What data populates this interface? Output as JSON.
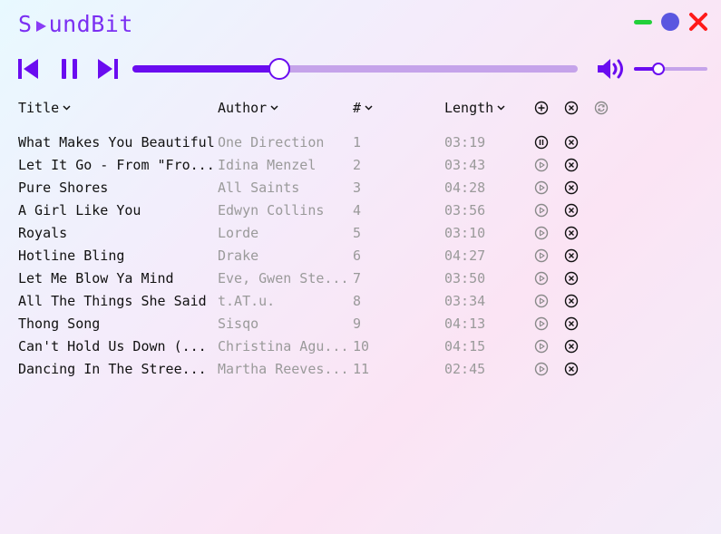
{
  "app": {
    "logo_prefix": "S",
    "logo_suffix": "undBit"
  },
  "window_controls": {
    "minimize": "minimize",
    "maximize": "maximize",
    "close": "close"
  },
  "player": {
    "progress_percent": 33,
    "volume_percent": 33,
    "state": "playing"
  },
  "columns": {
    "title": "Title",
    "author": "Author",
    "number": "#",
    "length": "Length"
  },
  "tracks": [
    {
      "title": "What Makes You Beautiful",
      "author": "One Direction",
      "num": "1",
      "length": "03:19",
      "playing": true
    },
    {
      "title": "Let It Go - From \"Fro...",
      "author": "Idina Menzel",
      "num": "2",
      "length": "03:43",
      "playing": false
    },
    {
      "title": "Pure Shores",
      "author": "All Saints",
      "num": "3",
      "length": "04:28",
      "playing": false
    },
    {
      "title": "A Girl Like You",
      "author": "Edwyn Collins",
      "num": "4",
      "length": "03:56",
      "playing": false
    },
    {
      "title": "Royals",
      "author": "Lorde",
      "num": "5",
      "length": "03:10",
      "playing": false
    },
    {
      "title": "Hotline Bling",
      "author": "Drake",
      "num": "6",
      "length": "04:27",
      "playing": false
    },
    {
      "title": "Let Me Blow Ya Mind",
      "author": "Eve, Gwen Ste...",
      "num": "7",
      "length": "03:50",
      "playing": false
    },
    {
      "title": "All The Things She Said",
      "author": "t.AT.u.",
      "num": "8",
      "length": "03:34",
      "playing": false
    },
    {
      "title": "Thong Song",
      "author": "Sisqo",
      "num": "9",
      "length": "04:13",
      "playing": false
    },
    {
      "title": "Can't Hold Us Down (...",
      "author": "Christina Agu...",
      "num": "10",
      "length": "04:15",
      "playing": false
    },
    {
      "title": "Dancing In The Stree...",
      "author": "Martha Reeves...",
      "num": "11",
      "length": "02:45",
      "playing": false
    }
  ],
  "colors": {
    "accent": "#6a0cf0",
    "accent_light": "#c5a3ea",
    "logo": "#7b2ff2",
    "minimize": "#22d03a",
    "maximize": "#5a57e0",
    "close": "#ff1a1a",
    "muted_text": "#9a9a9a"
  }
}
